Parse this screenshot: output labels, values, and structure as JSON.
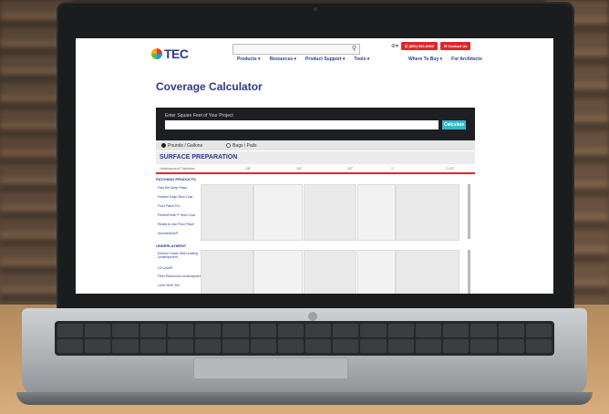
{
  "site": {
    "brand": "TEC",
    "nav": [
      "Products ▾",
      "Resources ▾",
      "Product Support ▾",
      "Tools ▾"
    ],
    "nav_right": [
      "Where To Buy ▾",
      "For Architects"
    ],
    "top_buttons": [
      "✆ (800) 000-0000",
      "✉ Contact Us"
    ],
    "globe": "⊕▾"
  },
  "page": {
    "title": "Coverage Calculator"
  },
  "calculator": {
    "label": "Enter Square Feet of Your Project",
    "button": "Calculate",
    "units": [
      "Pounds / Gallons",
      "Bags / Pails"
    ]
  },
  "section": {
    "title": "SURFACE PREPARATION",
    "col_label": "Underlayment Thickness",
    "columns": [
      "1/8\"",
      "1/4\"",
      "1/2\"",
      "1\"",
      "2 1/2\""
    ]
  },
  "groups": [
    {
      "title": "PATCHING PRODUCTS",
      "rows": [
        "Fast Set Deep Patch",
        "Feather Edge Skim Coat",
        "Floor Patch Pro",
        "PerfectFinish™ Skim Coat",
        "Ready to Use Floor Patch",
        "SmoothSkim®"
      ]
    },
    {
      "title": "UNDERLAYMENT",
      "rows": [
        "Exterior Grade Self-Leveling Underlayment",
        "LD Level®",
        "Fiber Reinforced Underlayment",
        "Level Set® 200"
      ]
    }
  ]
}
